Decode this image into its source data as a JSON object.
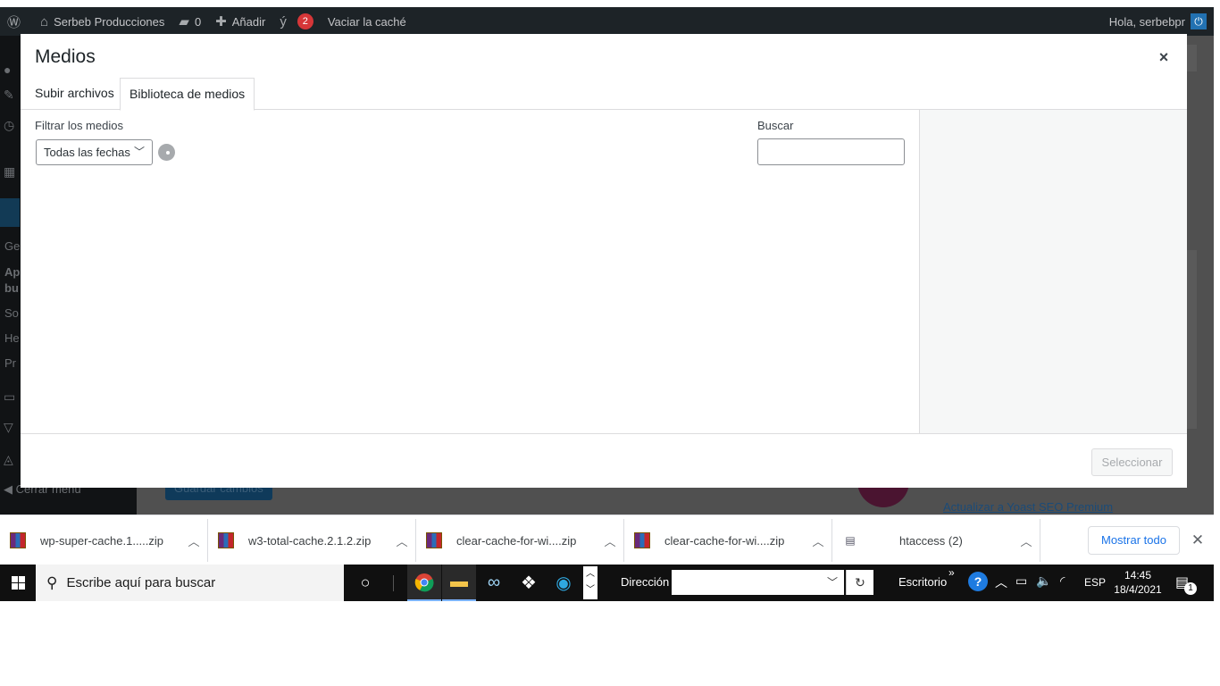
{
  "admin_bar": {
    "site_name": "Serbeb Producciones",
    "comments_count": "0",
    "add_label": "Añadir",
    "yoast_badge": "2",
    "clear_cache": "Vaciar la caché",
    "greeting": "Hola, serbebpr"
  },
  "background": {
    "save_button": "Guardar cambios",
    "yoast_link": "Actualizar a Yoast SEO Premium",
    "close_menu": "Cerrar menú",
    "menu_fragments": [
      "Ge",
      "Ap",
      "bu",
      "So",
      "He",
      "Pr"
    ]
  },
  "modal": {
    "title": "Medios",
    "close_symbol": "×",
    "tabs": [
      {
        "label": "Subir archivos"
      },
      {
        "label": "Biblioteca de medios"
      }
    ],
    "filter_label": "Filtrar los medios",
    "date_filter_value": "Todas las fechas",
    "search_label": "Buscar",
    "search_value": "",
    "select_button": "Seleccionar"
  },
  "downloads": {
    "items": [
      {
        "name": "wp-super-cache.1.....zip",
        "icon": "winrar-icon"
      },
      {
        "name": "w3-total-cache.2.1.2.zip",
        "icon": "winrar-icon"
      },
      {
        "name": "clear-cache-for-wi....zip",
        "icon": "winrar-icon"
      },
      {
        "name": "clear-cache-for-wi....zip",
        "icon": "winrar-icon"
      },
      {
        "name": "htaccess (2)",
        "icon": "file-icon"
      }
    ],
    "show_all": "Mostrar todo"
  },
  "taskbar": {
    "search_placeholder": "Escribe aquí para buscar",
    "address_label": "Dirección",
    "desktop_label": "Escritorio",
    "language": "ESP",
    "time": "14:45",
    "date": "18/4/2021",
    "notification_count": "1"
  },
  "colors": {
    "admin_bar": "#1d2327",
    "accent_blue": "#2271b1",
    "badge_red": "#d63638",
    "chrome_blue": "#1a73e8"
  }
}
